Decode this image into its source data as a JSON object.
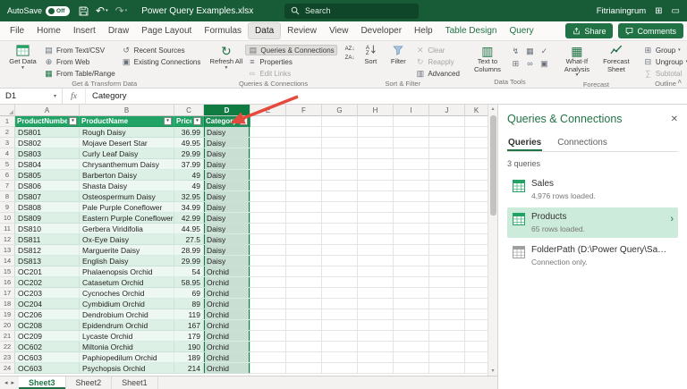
{
  "titlebar": {
    "autosave_label": "AutoSave",
    "autosave_state": "Off",
    "title": "Power Query Examples.xlsx",
    "search_placeholder": "Search",
    "user_name": "Fitrianingrum"
  },
  "ribbon_tabs": {
    "tabs": [
      {
        "label": "File"
      },
      {
        "label": "Home"
      },
      {
        "label": "Insert"
      },
      {
        "label": "Draw"
      },
      {
        "label": "Page Layout"
      },
      {
        "label": "Formulas"
      },
      {
        "label": "Data",
        "active": true
      },
      {
        "label": "Review"
      },
      {
        "label": "View"
      },
      {
        "label": "Developer"
      },
      {
        "label": "Help"
      },
      {
        "label": "Table Design",
        "contextual": true
      },
      {
        "label": "Query",
        "contextual": true
      }
    ],
    "share_label": "Share",
    "comments_label": "Comments"
  },
  "ribbon": {
    "get_data": "Get Data",
    "from_text_csv": "From Text/CSV",
    "from_web": "From Web",
    "from_table_range": "From Table/Range",
    "recent_sources": "Recent Sources",
    "existing_connections": "Existing Connections",
    "group_get_transform": "Get & Transform Data",
    "refresh_all": "Refresh All",
    "queries_connections": "Queries & Connections",
    "properties": "Properties",
    "edit_links": "Edit Links",
    "group_queries": "Queries & Connections",
    "sort_az": "AZ↓",
    "sort_za": "ZA↓",
    "sort": "Sort",
    "filter": "Filter",
    "clear": "Clear",
    "reapply": "Reapply",
    "advanced": "Advanced",
    "group_sort_filter": "Sort & Filter",
    "text_to_columns": "Text to Columns",
    "data_tools_icons": [
      {
        "name": "flash-fill",
        "glyph": "↯"
      },
      {
        "name": "remove-duplicates",
        "glyph": "▦"
      },
      {
        "name": "data-validation",
        "glyph": "✓"
      },
      {
        "name": "consolidate",
        "glyph": "⊞"
      },
      {
        "name": "relationships",
        "glyph": "∞"
      },
      {
        "name": "manage-data-model",
        "glyph": "▣"
      }
    ],
    "group_data_tools": "Data Tools",
    "what_if": "What-If Analysis",
    "forecast_sheet": "Forecast Sheet",
    "group_forecast": "Forecast",
    "group_btn": "Group",
    "ungroup": "Ungroup",
    "subtotal": "Subtotal",
    "group_outline": "Outline"
  },
  "formula_bar": {
    "name_box": "D1",
    "formula": "Category"
  },
  "grid": {
    "columns": [
      "A",
      "B",
      "C",
      "D",
      "E",
      "F",
      "G",
      "H",
      "I",
      "J",
      "K"
    ],
    "selected_column": "D",
    "table_headers": [
      "ProductNumber",
      "ProductName",
      "Price",
      "Category"
    ],
    "rows": [
      {
        "n": 2,
        "product_number": "DS801",
        "product_name": "Rough Daisy",
        "price": "36.99",
        "category": "Daisy"
      },
      {
        "n": 3,
        "product_number": "DS802",
        "product_name": "Mojave Desert Star",
        "price": "49.95",
        "category": "Daisy"
      },
      {
        "n": 4,
        "product_number": "DS803",
        "product_name": "Curly Leaf Daisy",
        "price": "29.99",
        "category": "Daisy"
      },
      {
        "n": 5,
        "product_number": "DS804",
        "product_name": "Chrysanthemum Daisy",
        "price": "37.99",
        "category": "Daisy"
      },
      {
        "n": 6,
        "product_number": "DS805",
        "product_name": "Barberton Daisy",
        "price": "49",
        "category": "Daisy"
      },
      {
        "n": 7,
        "product_number": "DS806",
        "product_name": "Shasta Daisy",
        "price": "49",
        "category": "Daisy"
      },
      {
        "n": 8,
        "product_number": "DS807",
        "product_name": "Osteospermum Daisy",
        "price": "32.95",
        "category": "Daisy"
      },
      {
        "n": 9,
        "product_number": "DS808",
        "product_name": "Pale Purple Coneflower",
        "price": "34.99",
        "category": "Daisy"
      },
      {
        "n": 10,
        "product_number": "DS809",
        "product_name": "Eastern Purple Coneflower",
        "price": "42.99",
        "category": "Daisy"
      },
      {
        "n": 11,
        "product_number": "DS810",
        "product_name": "Gerbera Viridifolia",
        "price": "44.95",
        "category": "Daisy"
      },
      {
        "n": 12,
        "product_number": "DS811",
        "product_name": "Ox-Eye Daisy",
        "price": "27.5",
        "category": "Daisy"
      },
      {
        "n": 13,
        "product_number": "DS812",
        "product_name": "Marguerite Daisy",
        "price": "28.99",
        "category": "Daisy"
      },
      {
        "n": 14,
        "product_number": "DS813",
        "product_name": "English Daisy",
        "price": "29.99",
        "category": "Daisy"
      },
      {
        "n": 15,
        "product_number": "OC201",
        "product_name": "Phalaenopsis Orchid",
        "price": "54",
        "category": "Orchid"
      },
      {
        "n": 16,
        "product_number": "OC202",
        "product_name": "Catasetum Orchid",
        "price": "58.95",
        "category": "Orchid"
      },
      {
        "n": 17,
        "product_number": "OC203",
        "product_name": "Cycnoches Orchid",
        "price": "69",
        "category": "Orchid"
      },
      {
        "n": 18,
        "product_number": "OC204",
        "product_name": "Cymbidium Orchid",
        "price": "89",
        "category": "Orchid"
      },
      {
        "n": 19,
        "product_number": "OC206",
        "product_name": "Dendrobium Orchid",
        "price": "119",
        "category": "Orchid"
      },
      {
        "n": 20,
        "product_number": "OC208",
        "product_name": "Epidendrum Orchid",
        "price": "167",
        "category": "Orchid"
      },
      {
        "n": 21,
        "product_number": "OC209",
        "product_name": "Lycaste Orchid",
        "price": "179",
        "category": "Orchid"
      },
      {
        "n": 22,
        "product_number": "OC602",
        "product_name": "Miltonia Orchid",
        "price": "190",
        "category": "Orchid"
      },
      {
        "n": 23,
        "product_number": "OC603",
        "product_name": "Paphiopedilum Orchid",
        "price": "189",
        "category": "Orchid"
      },
      {
        "n": 24,
        "product_number": "OC603",
        "product_name": "Psychopsis Orchid",
        "price": "214",
        "category": "Orchid"
      }
    ]
  },
  "queries_panel": {
    "title": "Queries & Connections",
    "tabs": [
      "Queries",
      "Connections"
    ],
    "active_tab": 0,
    "count_label": "3 queries",
    "items": [
      {
        "name": "Sales",
        "sub": "4,976 rows loaded.",
        "loaded": true
      },
      {
        "name": "Products",
        "sub": "65 rows loaded.",
        "loaded": true,
        "selected": true
      },
      {
        "name": "FolderPath (D:\\Power Query\\Sample f...",
        "sub": "Connection only.",
        "loaded": false
      }
    ]
  },
  "sheet_tabs": {
    "tabs": [
      {
        "label": "Sheet3",
        "active": true
      },
      {
        "label": "Sheet2"
      },
      {
        "label": "Sheet1"
      }
    ]
  },
  "annotation": {
    "arrow_color": "#e64a3c"
  }
}
